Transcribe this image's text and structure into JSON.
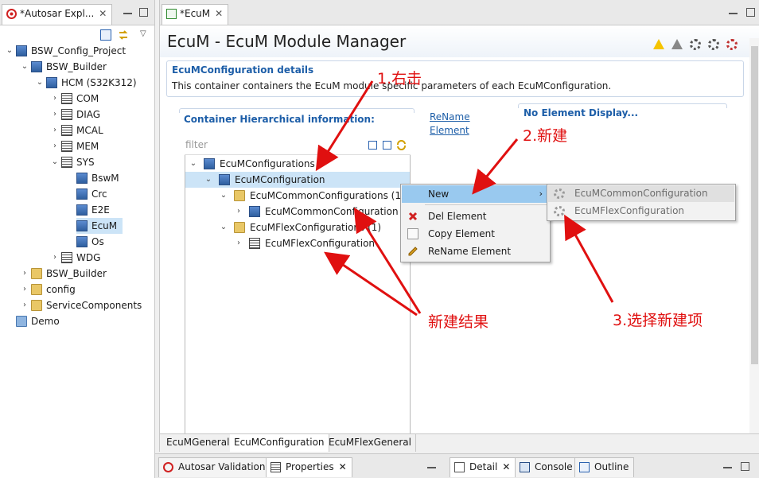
{
  "explorer": {
    "tab_label": "*Autosar Expl...",
    "tree": [
      {
        "label": "BSW_Config_Project",
        "expanded": true,
        "icon": "project-icon"
      },
      {
        "label": "BSW_Builder",
        "expanded": true,
        "icon": "builder-icon"
      },
      {
        "label": "HCM (S32K312)",
        "expanded": true,
        "icon": "chip-icon"
      },
      {
        "label": "COM",
        "expanded": false,
        "icon": "list-icon"
      },
      {
        "label": "DIAG",
        "expanded": false,
        "icon": "list-icon"
      },
      {
        "label": "MCAL",
        "expanded": false,
        "icon": "list-icon"
      },
      {
        "label": "MEM",
        "expanded": false,
        "icon": "list-icon"
      },
      {
        "label": "SYS",
        "expanded": true,
        "icon": "list-icon"
      },
      {
        "label": "BswM",
        "icon": "module-icon"
      },
      {
        "label": "Crc",
        "icon": "module-icon"
      },
      {
        "label": "E2E",
        "icon": "module-icon"
      },
      {
        "label": "EcuM",
        "icon": "module-icon",
        "selected": true
      },
      {
        "label": "Os",
        "icon": "module-icon"
      },
      {
        "label": "WDG",
        "expanded": false,
        "icon": "list-icon"
      },
      {
        "label": "BSW_Builder",
        "expanded": false,
        "icon": "folder-icon"
      },
      {
        "label": "config",
        "expanded": false,
        "icon": "folder-icon"
      },
      {
        "label": "ServiceComponents",
        "expanded": false,
        "icon": "folder-icon"
      },
      {
        "label": "Demo",
        "icon": "folder-blue-icon"
      }
    ]
  },
  "editor": {
    "tab_label": "*EcuM",
    "title": "EcuM - EcuM Module Manager",
    "details_title": "EcuMConfiguration details",
    "details_desc": "This container containers the EcuM module specific parameters of each EcuMConfiguration.",
    "hier_title": "Container Hierarchical information:",
    "links": [
      "ReName",
      "Element"
    ],
    "no_element_title": "No Element Display...",
    "filter_placeholder": "filter",
    "tree": [
      {
        "label": "EcuMConfigurations",
        "icon": "module-icon"
      },
      {
        "label": "EcuMConfiguration",
        "icon": "module-icon",
        "selected": true
      },
      {
        "label": "EcuMCommonConfigurations (1)",
        "icon": "folder-icon"
      },
      {
        "label": "EcuMCommonConfiguration",
        "icon": "module-icon"
      },
      {
        "label": "EcuMFlexConfigurations (1)",
        "icon": "folder-icon"
      },
      {
        "label": "EcuMFlexConfiguration",
        "icon": "page-icon"
      }
    ],
    "bottom_tabs": [
      "EcuMGeneral",
      "EcuMConfiguration",
      "EcuMFlexGeneral"
    ],
    "active_bottom_tab": "EcuMConfiguration"
  },
  "context_menu": {
    "items": [
      {
        "label": "New",
        "icon": "",
        "submenu": true,
        "highlighted": true
      },
      {
        "label": "Del Element",
        "icon": "delete-icon"
      },
      {
        "label": "Copy Element",
        "icon": "copy-icon"
      },
      {
        "label": "ReName Element",
        "icon": "pencil-icon"
      }
    ],
    "submenu": [
      "EcuMCommonConfiguration",
      "EcuMFlexConfiguration"
    ]
  },
  "bottom_views": {
    "left": [
      "Autosar Validation",
      "Properties"
    ],
    "right": [
      "Detail",
      "Console",
      "Outline"
    ]
  },
  "annotations": {
    "step1": "1.右击",
    "step2": "2.新建",
    "step3": "3.选择新建项",
    "result": "新建结果"
  },
  "colors": {
    "link_blue": "#1d5ea8",
    "annotation_red": "#e01010",
    "menu_highlight": "#99c9ef",
    "selection": "#cce4f7"
  }
}
